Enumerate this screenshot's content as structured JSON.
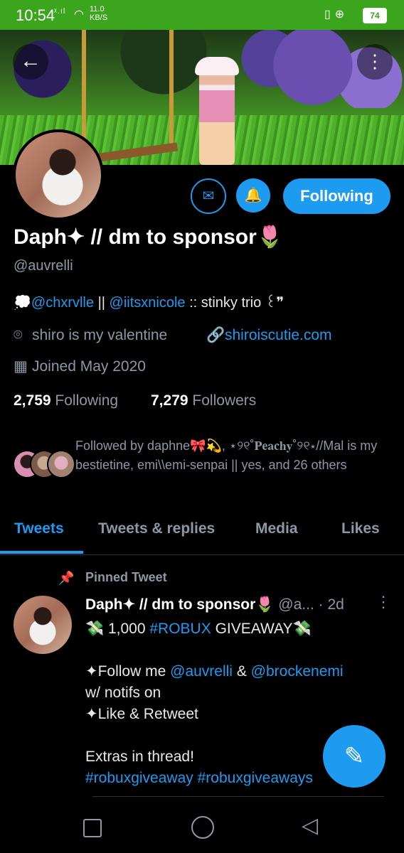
{
  "status_bar": {
    "time": "10:54",
    "network_speed": "11.0",
    "network_unit": "KB/S",
    "battery": "74",
    "icons": [
      "signal-icon",
      "wifi-icon",
      "vibrate-icon",
      "lock-icon",
      "battery-icon"
    ]
  },
  "header": {
    "back_icon": "arrow-left-icon",
    "more_icon": "more-vertical-icon"
  },
  "profile": {
    "display_name": "Daph✦ // dm to sponsor🌷",
    "handle": "@auvrelli",
    "bio_prefix": "💭",
    "bio_link1": "@chxrvlle",
    "bio_sep": " || ",
    "bio_link2": "@iitsxnicole",
    "bio_suffix": " :: stinky trio ꒰❞",
    "location": "shiro is my valentine",
    "website": "shiroiscutie.com",
    "joined": "Joined May 2020",
    "following_count": "2,759",
    "following_label": "Following",
    "followers_count": "7,279",
    "followers_label": "Followers",
    "followed_by": "Followed by daphne🎀💫, ⋆୨୧˚𝐏𝐞𝐚𝐜𝐡𝐲˚୨୧⋆//Mal is my bestietine, emi\\\\emi-senpai || yes, and 26 others"
  },
  "actions": {
    "message_icon": "mail-icon",
    "notify_icon": "bell-check-icon",
    "follow_label": "Following"
  },
  "tabs": [
    {
      "label": "Tweets",
      "active": true
    },
    {
      "label": "Tweets & replies",
      "active": false
    },
    {
      "label": "Media",
      "active": false
    },
    {
      "label": "Likes",
      "active": false
    }
  ],
  "pinned_tweet": {
    "pinned_label": "Pinned Tweet",
    "author": "Daph✦ // dm to sponsor🌷",
    "handle_truncated": "@a...",
    "time": "· 2d",
    "lines": [
      {
        "pre": "💸 1,000 ",
        "link": "#ROBUX",
        "post": " GIVEAWAY💸"
      },
      {
        "pre": "",
        "link": "",
        "post": ""
      },
      {
        "pre": "✦Follow me ",
        "link": "@auvrelli",
        "post": " & ",
        "link2": "@brockenemi"
      },
      {
        "pre": "w/ notifs on",
        "link": "",
        "post": ""
      },
      {
        "pre": "✦Like & Retweet",
        "link": "",
        "post": ""
      },
      {
        "pre": "",
        "link": "",
        "post": ""
      },
      {
        "pre": "Extras in thread!",
        "link": "",
        "post": ""
      },
      {
        "pre": "",
        "link": "#robuxgiveaway",
        "post": " ",
        "link2": "#robuxgiveaways"
      }
    ]
  },
  "fab": {
    "icon": "compose-tweet-icon"
  },
  "nav": {
    "icons": [
      "recent-apps-icon",
      "home-icon",
      "back-triangle-icon"
    ]
  },
  "colors": {
    "accent": "#1d9bf0",
    "status_bar": "#3ba51e",
    "muted": "#8b98a5"
  }
}
